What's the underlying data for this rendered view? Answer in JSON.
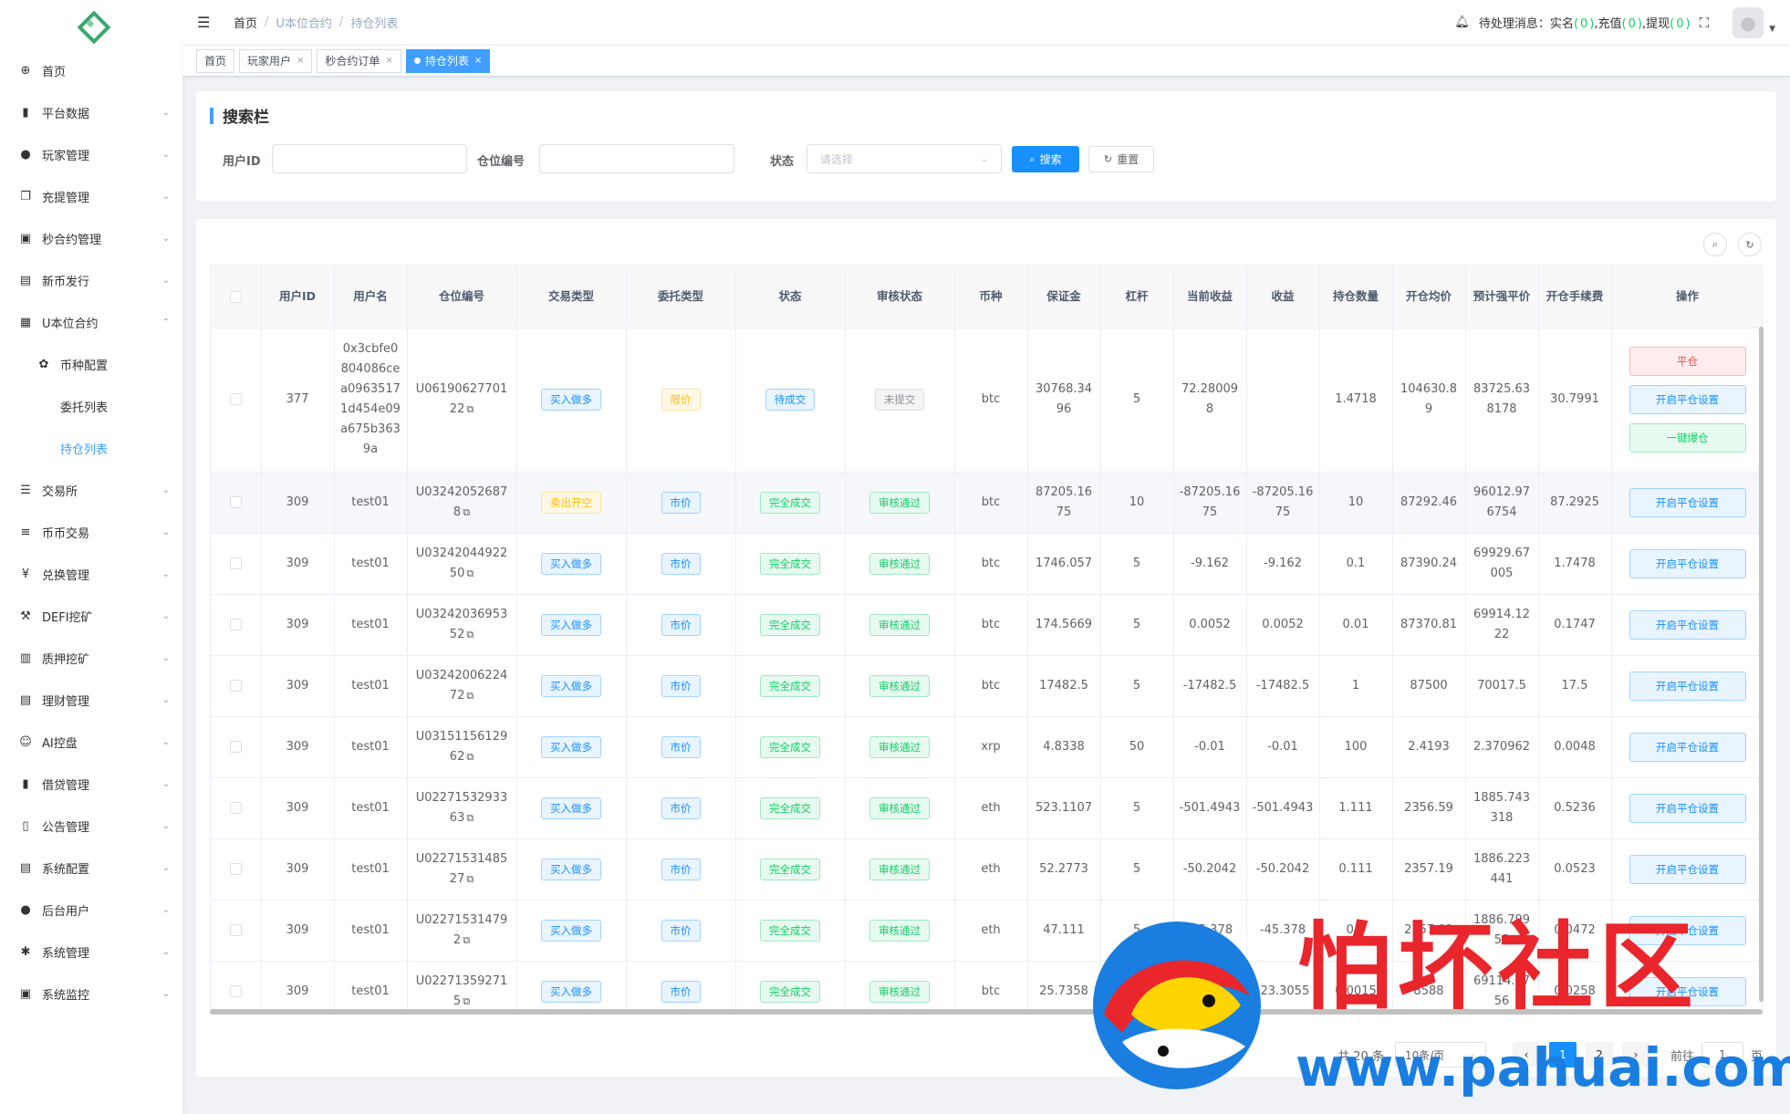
{
  "sidebar": {
    "items": [
      {
        "label": "首页",
        "icon": "dashboard-icon",
        "glyph": "⊕",
        "arrow": ""
      },
      {
        "label": "平台数据",
        "icon": "book-icon",
        "glyph": "▮",
        "arrow": "⌄"
      },
      {
        "label": "玩家管理",
        "icon": "user-icon",
        "glyph": "●",
        "arrow": "⌄"
      },
      {
        "label": "充提管理",
        "icon": "copy-icon",
        "glyph": "❐",
        "arrow": "⌄"
      },
      {
        "label": "秒合约管理",
        "icon": "monitor-icon",
        "glyph": "▣",
        "arrow": "⌄"
      },
      {
        "label": "新币发行",
        "icon": "coin-icon",
        "glyph": "▤",
        "arrow": "⌄"
      },
      {
        "label": "U本位合约",
        "icon": "table-icon",
        "glyph": "▦",
        "arrow": "⌃"
      }
    ],
    "sub_items": [
      {
        "label": "币种配置",
        "icon": "settings-icon",
        "glyph": "✿"
      },
      {
        "label": "委托列表"
      },
      {
        "label": "持仓列表"
      }
    ],
    "more_items": [
      {
        "label": "交易所",
        "icon": "list-icon",
        "glyph": "☰",
        "arrow": "⌄"
      },
      {
        "label": "币币交易",
        "icon": "list-icon",
        "glyph": "≡",
        "arrow": "⌄"
      },
      {
        "label": "兑换管理",
        "icon": "yen-icon",
        "glyph": "¥",
        "arrow": "⌄"
      },
      {
        "label": "DEFI挖矿",
        "icon": "mining-icon",
        "glyph": "⚒",
        "arrow": "⌄"
      },
      {
        "label": "质押挖矿",
        "icon": "chart-icon",
        "glyph": "▥",
        "arrow": "⌄"
      },
      {
        "label": "理财管理",
        "icon": "document-icon",
        "glyph": "▤",
        "arrow": "⌄"
      },
      {
        "label": "AI控盘",
        "icon": "robot-icon",
        "glyph": "☺",
        "arrow": "⌄"
      },
      {
        "label": "借贷管理",
        "icon": "book-icon",
        "glyph": "▮",
        "arrow": "⌄"
      },
      {
        "label": "公告管理",
        "icon": "open-book-icon",
        "glyph": "▯",
        "arrow": "⌄"
      },
      {
        "label": "系统配置",
        "icon": "document-icon",
        "glyph": "▤",
        "arrow": "⌄"
      },
      {
        "label": "后台用户",
        "icon": "users-icon",
        "glyph": "●",
        "arrow": "⌄"
      },
      {
        "label": "系统管理",
        "icon": "gear-icon",
        "glyph": "✱",
        "arrow": "⌄"
      },
      {
        "label": "系统监控",
        "icon": "monitor-icon",
        "glyph": "▣",
        "arrow": "⌄"
      }
    ]
  },
  "header": {
    "breadcrumb": [
      "首页",
      "U本位合约",
      "持仓列表"
    ],
    "notice_label": "待处理消息：",
    "notices": [
      {
        "label": "实名",
        "count": "0"
      },
      {
        "label": "充值",
        "count": "0"
      },
      {
        "label": "提现",
        "count": "0"
      }
    ]
  },
  "tags": [
    {
      "label": "首页",
      "closable": false
    },
    {
      "label": "玩家用户",
      "closable": true
    },
    {
      "label": "秒合约订单",
      "closable": true
    },
    {
      "label": "持仓列表",
      "closable": true,
      "active": true
    }
  ],
  "search": {
    "title": "搜索栏",
    "user_id_label": "用户ID",
    "position_no_label": "仓位编号",
    "status_label": "状态",
    "status_placeholder": "请选择",
    "search_button": "搜索",
    "reset_button": "重置"
  },
  "table": {
    "columns": [
      "用户ID",
      "用户名",
      "仓位编号",
      "交易类型",
      "委托类型",
      "状态",
      "审核状态",
      "币种",
      "保证金",
      "杠杆",
      "当前收益",
      "收益",
      "持仓数量",
      "开仓均价",
      "预计强平价",
      "开仓手续费",
      "操作"
    ],
    "rows": [
      {
        "user_id": "377",
        "username": "0x3cbfe0804086cea09635171d454e09a675b3639a",
        "position_no": "U0619062770122",
        "trade_type": "买入做多",
        "trade_color": "blue",
        "order_type": "限价",
        "order_color": "yellow",
        "status": "待成交",
        "status_color": "blue",
        "audit": "未提交",
        "audit_color": "gray",
        "coin": "btc",
        "margin": "30768.3496",
        "leverage": "5",
        "current_profit": "72.280098",
        "profit": "",
        "qty": "1.4718",
        "open_price": "104630.89",
        "liq_price": "83725.638178",
        "fee": "30.7991",
        "ops": [
          "平仓",
          "开启平仓设置",
          "一键爆仓"
        ]
      },
      {
        "user_id": "309",
        "username": "test01",
        "position_no": "U032420526878",
        "trade_type": "卖出开空",
        "trade_color": "yellow",
        "order_type": "市价",
        "order_color": "blue",
        "status": "完全成交",
        "status_color": "green",
        "audit": "审核通过",
        "audit_color": "green",
        "coin": "btc",
        "margin": "87205.1675",
        "leverage": "10",
        "current_profit": "-87205.1675",
        "profit": "-87205.1675",
        "qty": "10",
        "open_price": "87292.46",
        "liq_price": "96012.976754",
        "fee": "87.2925",
        "ops": [
          "开启平仓设置"
        ]
      },
      {
        "user_id": "309",
        "username": "test01",
        "position_no": "U0324204492250",
        "trade_type": "买入做多",
        "trade_color": "blue",
        "order_type": "市价",
        "order_color": "blue",
        "status": "完全成交",
        "status_color": "green",
        "audit": "审核通过",
        "audit_color": "green",
        "coin": "btc",
        "margin": "1746.057",
        "leverage": "5",
        "current_profit": "-9.162",
        "profit": "-9.162",
        "qty": "0.1",
        "open_price": "87390.24",
        "liq_price": "69929.67005",
        "fee": "1.7478",
        "ops": [
          "开启平仓设置"
        ]
      },
      {
        "user_id": "309",
        "username": "test01",
        "position_no": "U0324203695352",
        "trade_type": "买入做多",
        "trade_color": "blue",
        "order_type": "市价",
        "order_color": "blue",
        "status": "完全成交",
        "status_color": "green",
        "audit": "审核通过",
        "audit_color": "green",
        "coin": "btc",
        "margin": "174.5669",
        "leverage": "5",
        "current_profit": "0.0052",
        "profit": "0.0052",
        "qty": "0.01",
        "open_price": "87370.81",
        "liq_price": "69914.1222",
        "fee": "0.1747",
        "ops": [
          "开启平仓设置"
        ]
      },
      {
        "user_id": "309",
        "username": "test01",
        "position_no": "U0324200622472",
        "trade_type": "买入做多",
        "trade_color": "blue",
        "order_type": "市价",
        "order_color": "blue",
        "status": "完全成交",
        "status_color": "green",
        "audit": "审核通过",
        "audit_color": "green",
        "coin": "btc",
        "margin": "17482.5",
        "leverage": "5",
        "current_profit": "-17482.5",
        "profit": "-17482.5",
        "qty": "1",
        "open_price": "87500",
        "liq_price": "70017.5",
        "fee": "17.5",
        "ops": [
          "开启平仓设置"
        ]
      },
      {
        "user_id": "309",
        "username": "test01",
        "position_no": "U0315115612962",
        "trade_type": "买入做多",
        "trade_color": "blue",
        "order_type": "市价",
        "order_color": "blue",
        "status": "完全成交",
        "status_color": "green",
        "audit": "审核通过",
        "audit_color": "green",
        "coin": "xrp",
        "margin": "4.8338",
        "leverage": "50",
        "current_profit": "-0.01",
        "profit": "-0.01",
        "qty": "100",
        "open_price": "2.4193",
        "liq_price": "2.370962",
        "fee": "0.0048",
        "ops": [
          "开启平仓设置"
        ]
      },
      {
        "user_id": "309",
        "username": "test01",
        "position_no": "U0227153293363",
        "trade_type": "买入做多",
        "trade_color": "blue",
        "order_type": "市价",
        "order_color": "blue",
        "status": "完全成交",
        "status_color": "green",
        "audit": "审核通过",
        "audit_color": "green",
        "coin": "eth",
        "margin": "523.1107",
        "leverage": "5",
        "current_profit": "-501.4943",
        "profit": "-501.4943",
        "qty": "1.111",
        "open_price": "2356.59",
        "liq_price": "1885.743318",
        "fee": "0.5236",
        "ops": [
          "开启平仓设置"
        ]
      },
      {
        "user_id": "309",
        "username": "test01",
        "position_no": "U0227153148527",
        "trade_type": "买入做多",
        "trade_color": "blue",
        "order_type": "市价",
        "order_color": "blue",
        "status": "完全成交",
        "status_color": "green",
        "audit": "审核通过",
        "audit_color": "green",
        "coin": "eth",
        "margin": "52.2773",
        "leverage": "5",
        "current_profit": "-50.2042",
        "profit": "-50.2042",
        "qty": "0.111",
        "open_price": "2357.19",
        "liq_price": "1886.223441",
        "fee": "0.0523",
        "ops": [
          "开启平仓设置"
        ]
      },
      {
        "user_id": "309",
        "username": "test01",
        "position_no": "U022715314792",
        "trade_type": "买入做多",
        "trade_color": "blue",
        "order_type": "市价",
        "order_color": "blue",
        "status": "完全成交",
        "status_color": "green",
        "audit": "审核通过",
        "audit_color": "green",
        "coin": "eth",
        "margin": "47.111",
        "leverage": "5",
        "current_profit": "-45.378",
        "profit": "-45.378",
        "qty": "0.1",
        "open_price": "2357.91",
        "liq_price": "1886.79958",
        "fee": "0.0472",
        "ops": [
          "开启平仓设置"
        ]
      },
      {
        "user_id": "309",
        "username": "test01",
        "position_no": "U022713592715",
        "trade_type": "买入做多",
        "trade_color": "blue",
        "order_type": "市价",
        "order_color": "blue",
        "status": "完全成交",
        "status_color": "green",
        "audit": "审核通过",
        "audit_color": "green",
        "coin": "btc",
        "margin": "25.7358",
        "leverage": "5",
        "current_profit": "-23.3055",
        "profit": "-23.3055",
        "qty": "0.0015",
        "open_price": "8588",
        "liq_price": "69114.7756",
        "fee": "0.0258",
        "ops": [
          "开启平仓设置"
        ]
      }
    ]
  },
  "pagination": {
    "total": "共 20 条",
    "page_size": "10条/页",
    "pages": [
      "1",
      "2"
    ],
    "current": "1",
    "goto_label": "前往",
    "goto_value": "1",
    "page_suffix": "页"
  },
  "watermark": {
    "cn": "怕坏社区",
    "url": "www.pahuai.com"
  },
  "colors": {
    "primary": "#1890ff",
    "success": "#13ce66",
    "danger": "#ff4949",
    "warning": "#ffba00",
    "watermark_red": "#e8262c",
    "watermark_blue": "#1a7ee0"
  }
}
